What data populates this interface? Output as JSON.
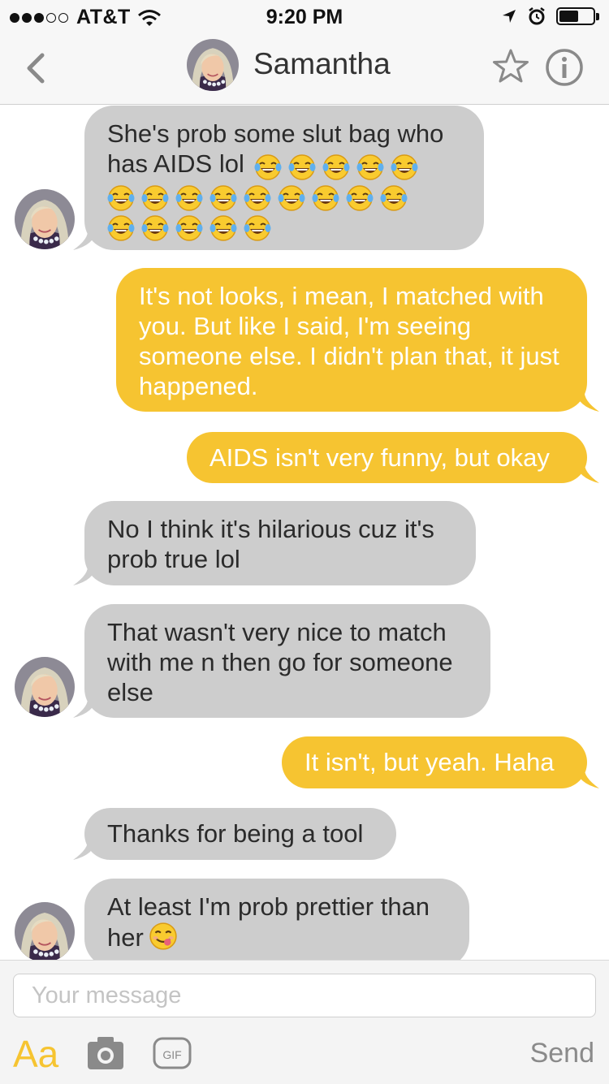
{
  "status_bar": {
    "carrier": "AT&T",
    "time": "9:20 PM",
    "signal_bars_filled": 3,
    "signal_bars_total": 5,
    "battery_level": 0.62
  },
  "nav": {
    "title": "Samantha",
    "icons": [
      "back-chevron-icon",
      "star-icon",
      "info-icon"
    ]
  },
  "messages": [
    {
      "from": "them",
      "text": "She's prob some slut bag who has AIDS lol",
      "emoji": "face-with-tears-of-joy",
      "emoji_counts": [
        5,
        9,
        5
      ]
    },
    {
      "from": "me",
      "text": "It's not looks, i mean, I matched with you. But like I said, I'm seeing someone else. I didn't plan that, it just happened."
    },
    {
      "from": "me",
      "text": "AIDS isn't very funny, but okay"
    },
    {
      "from": "them",
      "text": "No I think it's hilarious cuz it's prob true lol"
    },
    {
      "from": "them",
      "text": "That wasn't very nice to match with me n then go for someone else"
    },
    {
      "from": "me",
      "text": "It isn't, but yeah. Haha"
    },
    {
      "from": "them",
      "text": "Thanks for being a tool"
    },
    {
      "from": "them",
      "text": "At least I'm prob prettier than her",
      "emoji": "face-savoring-food"
    }
  ],
  "composer": {
    "placeholder": "Your message",
    "font_button": "Aa",
    "gif_label": "GIF",
    "send_label": "Send"
  },
  "colors": {
    "outgoing_bubble": "#f6c431",
    "incoming_bubble": "#cdcdcd",
    "accent": "#f6c431",
    "bar_background": "#f7f7f7"
  }
}
